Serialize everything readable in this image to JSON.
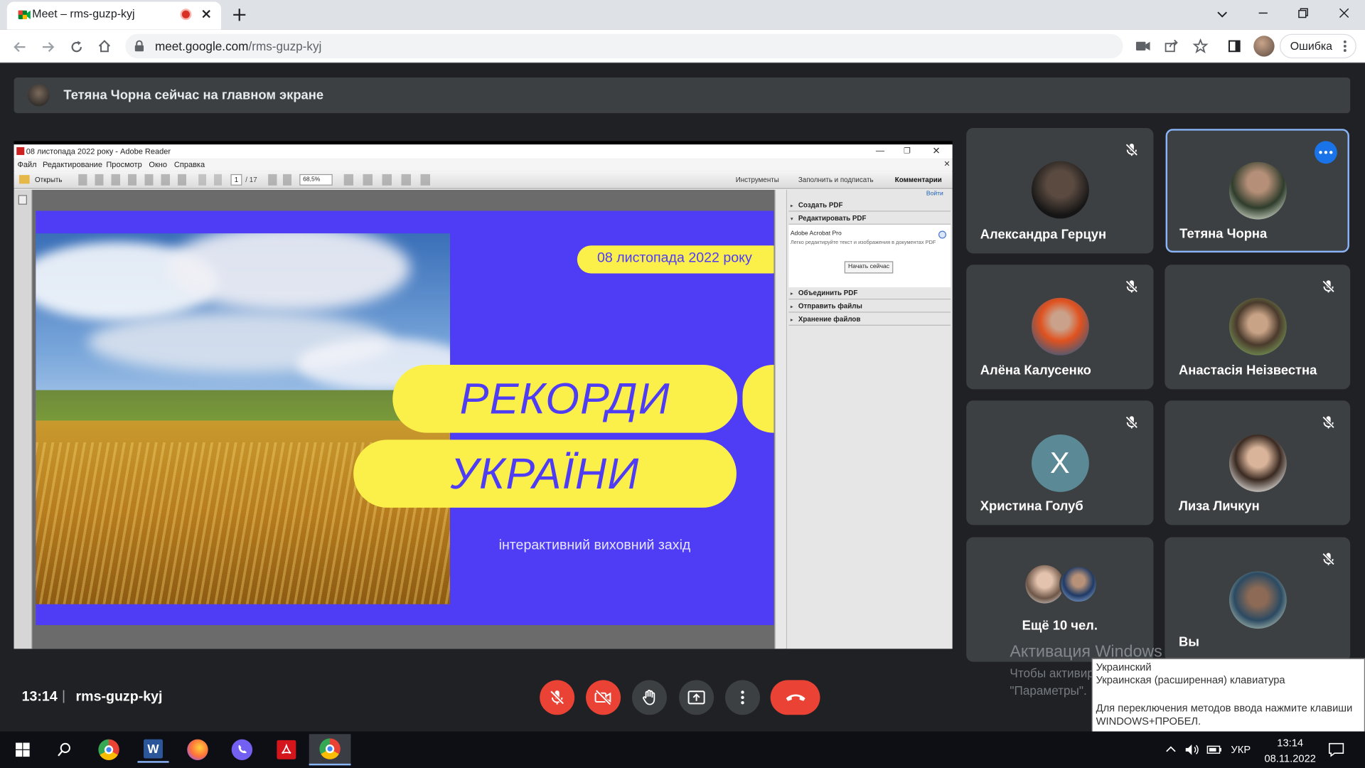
{
  "browser": {
    "tab_title": "Meet – rms-guzp-kyj",
    "url_domain": "meet.google.com",
    "url_path": "/rms-guzp-kyj",
    "profile_error_label": "Ошибка",
    "icons": [
      "meet-favicon",
      "recording-dot-icon",
      "close-tab-icon",
      "new-tab-icon",
      "back-icon",
      "forward-icon",
      "reload-icon",
      "home-icon",
      "lock-icon",
      "camera-blocked-icon",
      "share-icon",
      "bookmark-star-icon",
      "side-panel-icon",
      "profile-avatar",
      "menu-icon"
    ]
  },
  "banner": {
    "text": "Тетяна Чорна сейчас на главном экране"
  },
  "shared_screen": {
    "window_title": "08 листопада 2022 року - Adobe Reader",
    "menu": [
      "Файл",
      "Редактирование",
      "Просмотр",
      "Окно",
      "Справка"
    ],
    "toolbar_open": "Открыть",
    "page_current": "1",
    "page_total": "/ 17",
    "zoom": "68,5%",
    "right_tabs": [
      "Инструменты",
      "Заполнить и подписать",
      "Комментарии"
    ],
    "login_link": "Войти",
    "panel": {
      "create_pdf": "Создать PDF",
      "edit_pdf": "Редактировать PDF",
      "acrobat_title": "Adobe Acrobat Pro",
      "acrobat_desc": "Легко редактируйте текст и изображения в документах PDF",
      "start_button": "Начать сейчас",
      "combine_pdf": "Объединить PDF",
      "send_files": "Отправить файлы",
      "store_files": "Хранение файлов"
    },
    "slide": {
      "date": "08 листопада 2022 року",
      "title_line1": "РЕКОРДИ",
      "title_line2": "УКРАЇНИ",
      "subtitle": "інтерактивний виховний захід",
      "bg_color": "#4f3cf5",
      "accent_color": "#fbf04a"
    }
  },
  "participants": [
    {
      "name": "Александра Герцун",
      "muted": true
    },
    {
      "name": "Тетяна Чорна",
      "muted": false,
      "active": true
    },
    {
      "name": "Алёна Калусенко",
      "muted": true
    },
    {
      "name": "Анастасія Неізвестна",
      "muted": true
    },
    {
      "name": "Христина Голуб",
      "muted": true,
      "initial": "Х"
    },
    {
      "name": "Лиза Личкун",
      "muted": true
    },
    {
      "name": "Ещё 10 чел.",
      "muted": false
    },
    {
      "name": "Вы",
      "muted": true
    }
  ],
  "meeting": {
    "time": "13:14",
    "separator": "|",
    "code": "rms-guzp-kyj"
  },
  "watermark": {
    "title": "Активация Windows",
    "line1": "Чтобы активировать Windows, перейдите в раздел",
    "line2": "\"Параметры\"."
  },
  "tooltip": {
    "line1": "Украинский",
    "line2": "Украинская (расширенная) клавиатура",
    "line3": "Для переключения методов ввода нажмите клавиши",
    "line4": "WINDOWS+ПРОБЕЛ."
  },
  "taskbar": {
    "lang": "УКР",
    "time": "13:14",
    "date": "08.11.2022"
  },
  "colors": {
    "meet_bg": "#202124",
    "tile_bg": "#3c4043",
    "danger": "#ea4335",
    "active_border": "#8ab4f8",
    "more_button": "#1a73e8"
  }
}
